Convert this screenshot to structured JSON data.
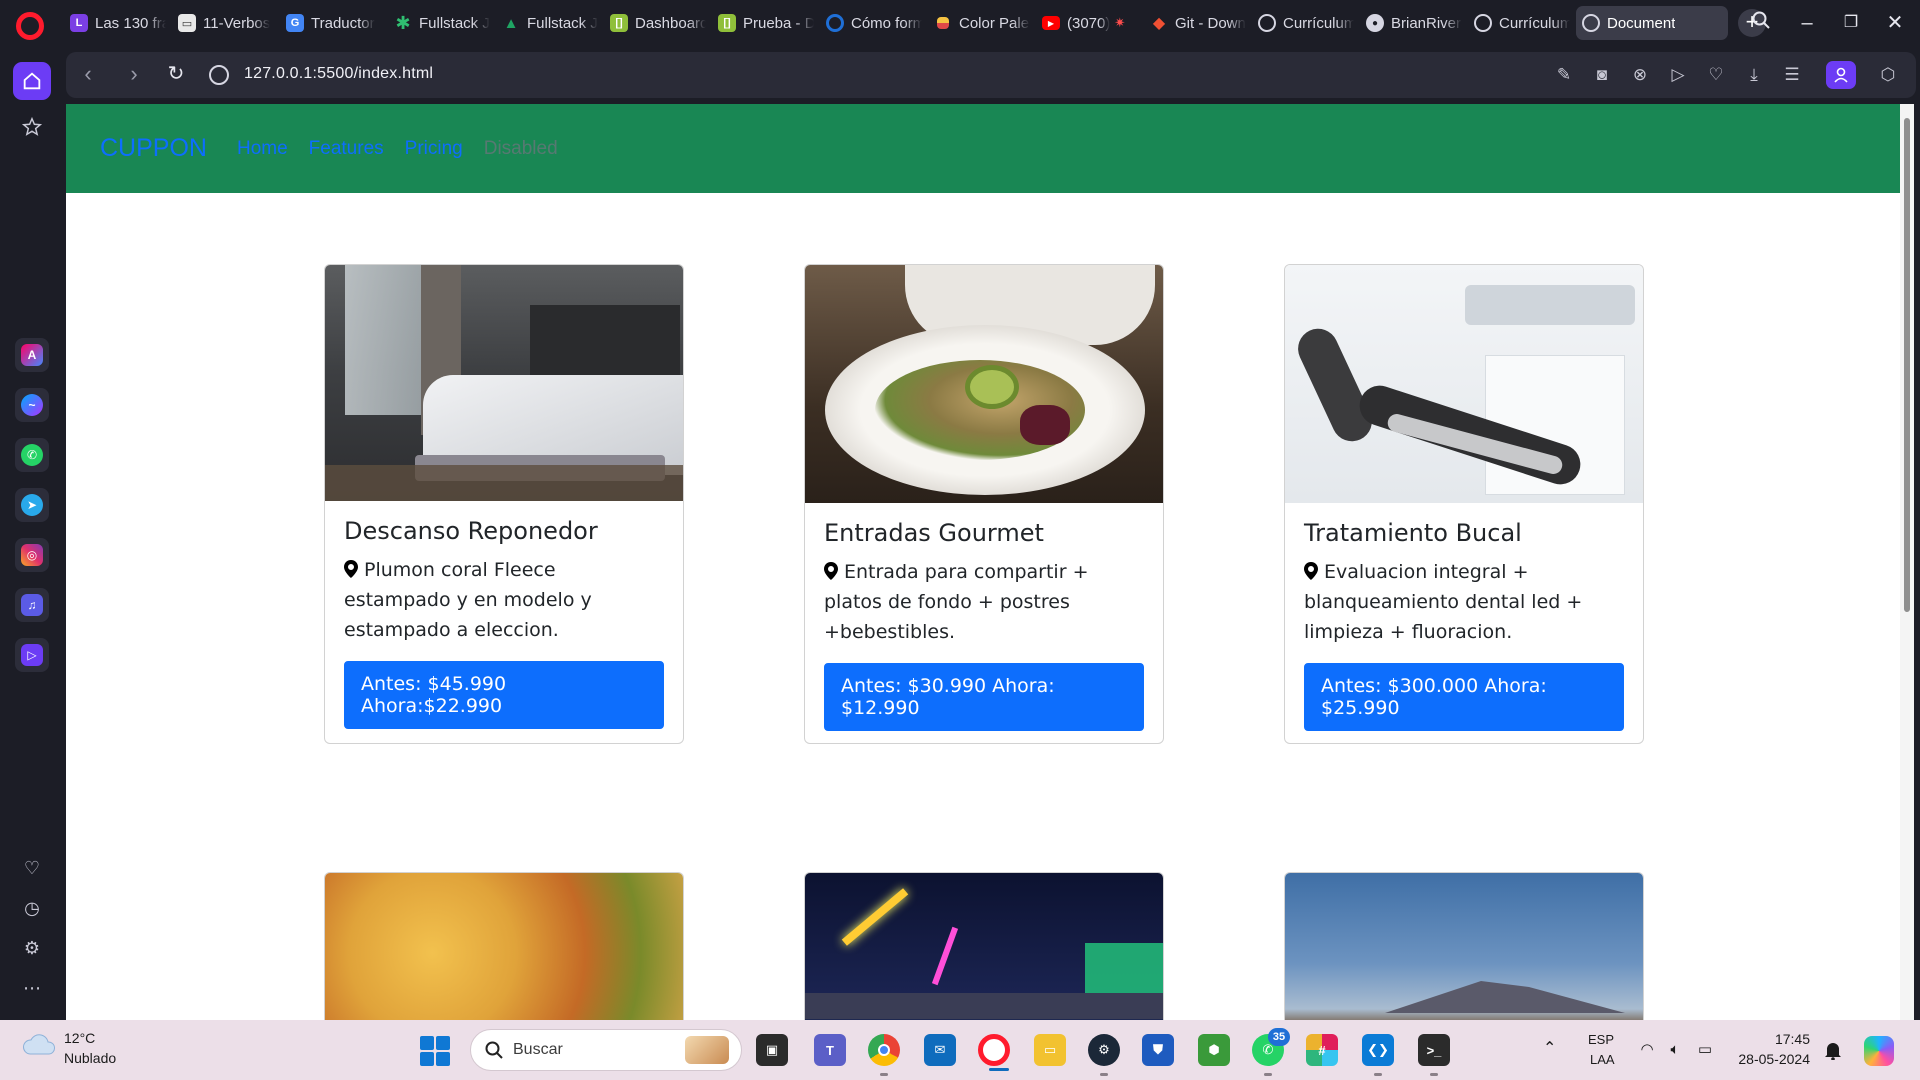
{
  "browser": {
    "tabs": [
      {
        "title": "Las 130 frases",
        "color": "#7b3fe4",
        "glyph": "L"
      },
      {
        "title": "11-Verbos",
        "color": "#e8e8e8",
        "glyph": "▭"
      },
      {
        "title": "Traductor",
        "color": "#4285f4",
        "glyph": "G"
      },
      {
        "title": "Fullstack J",
        "color": "#2fbf71",
        "glyph": "✱"
      },
      {
        "title": "Fullstack J",
        "color": "#1fa463",
        "glyph": "▲"
      },
      {
        "title": "Dashboard",
        "color": "#8fbf3a",
        "glyph": "[]"
      },
      {
        "title": "Prueba - D",
        "color": "#8fbf3a",
        "glyph": "[]"
      },
      {
        "title": "Cómo forma",
        "color": "#1f6fd6",
        "glyph": "◐"
      },
      {
        "title": "Color Palet",
        "color": "#f6c342",
        "glyph": "▪"
      },
      {
        "title": "(3070)",
        "color": "#ff0000",
        "glyph": "▶"
      },
      {
        "title": "Git - Down",
        "color": "#f05033",
        "glyph": "◆"
      },
      {
        "title": "Currículum",
        "color": "#d6d6e2",
        "glyph": "◍"
      },
      {
        "title": "BrianRivera",
        "color": "#d6d6e2",
        "glyph": "●"
      },
      {
        "title": "Currículum",
        "color": "#d6d6e2",
        "glyph": "◍"
      },
      {
        "title": "Document",
        "color": "#d6d6e2",
        "glyph": "◍"
      }
    ],
    "url": "127.0.0.1:5500/index.html",
    "accent": "#6c3cf5"
  },
  "page": {
    "brand": "CUPPON",
    "nav_links": [
      "Home",
      "Features",
      "Pricing",
      "Disabled"
    ],
    "navbar_color": "#198754",
    "link_color": "#0d6efd",
    "cards": [
      {
        "title": "Descanso Reponedor",
        "text": "Plumon coral Fleece estampado y en modelo y estampado a eleccion.",
        "button": "Antes: $45.990 Ahora:$22.990"
      },
      {
        "title": "Entradas Gourmet",
        "text": "Entrada para compartir + platos de fondo + postres +bebestibles.",
        "button": "Antes: $30.990 Ahora: $12.990"
      },
      {
        "title": "Tratamiento Bucal",
        "text": "Evaluacion integral + blanqueamiento dental led + limpieza + fluoracion.",
        "button": "Antes: $300.000 Ahora: $25.990"
      }
    ]
  },
  "taskbar": {
    "weather_temp": "12°C",
    "weather_desc": "Nublado",
    "search_placeholder": "Buscar",
    "whatsapp_badge": "35",
    "lang_top": "ESP",
    "lang_bottom": "LAA",
    "time": "17:45",
    "date": "28-05-2024"
  }
}
